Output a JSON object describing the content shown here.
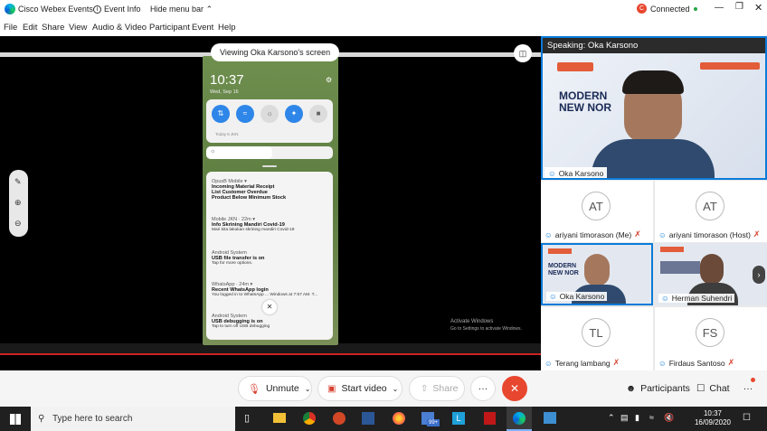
{
  "window": {
    "app_title": "Cisco Webex Events",
    "event_info": "Event Info",
    "hide_menu": "Hide menu bar",
    "status": "Connected"
  },
  "menu": [
    "File",
    "Edit",
    "Share",
    "View",
    "Audio & Video",
    "Participant",
    "Event",
    "Help"
  ],
  "share": {
    "banner": "Viewing Oka Karsono's screen",
    "activate_title": "Activate Windows",
    "activate_sub": "Go to Settings to activate Windows."
  },
  "phone": {
    "time": "10:37",
    "date": "Wed, Sep 16",
    "weather": "Today 5 JKN",
    "notifications": [
      {
        "app": "OpusB Mobile ▾",
        "lines": [
          {
            "title": "Incoming Material Receipt",
            "text": "Incoming Material Rec..."
          },
          {
            "title": "List Customer Overdue",
            "text": "List Customer Overdue • 9..."
          },
          {
            "title": "Product Below Minimum Stock",
            "text": "There are product..."
          }
        ]
      },
      {
        "app": "Mobile JKN · 22m ▾",
        "lines": [
          {
            "title": "Info Skrining Mandiri Covid-19",
            "text": "Mari kita lakukan skrining mandiri Covid-19"
          }
        ]
      },
      {
        "app": "Android System",
        "lines": [
          {
            "title": "USB file transfer is on",
            "text": "Tap for more options."
          }
        ]
      },
      {
        "app": "WhatsApp · 24m ▾",
        "lines": [
          {
            "title": "Recent WhatsApp login",
            "text": "You logged in to WhatsApp ... Windows at 7:57 AM. T..."
          }
        ]
      },
      {
        "app": "Android System",
        "lines": [
          {
            "title": "USB debugging is on",
            "text": "Tap to turn off USB debugging"
          }
        ]
      }
    ]
  },
  "panel": {
    "speaking_label": "Speaking: Oka Karsono",
    "slide_title": "MODERN NEW NOR",
    "speaker_name": "Oka Karsono",
    "participants": [
      {
        "initials": "AT",
        "name": "ariyani timorason (Me)"
      },
      {
        "initials": "AT",
        "name": "ariyani timorason (Host)"
      },
      {
        "initials": "",
        "name": "Oka Karsono"
      },
      {
        "initials": "",
        "name": "Herman Suhendri"
      },
      {
        "initials": "TL",
        "name": "Terang lambang"
      },
      {
        "initials": "FS",
        "name": "Firdaus Santoso"
      }
    ]
  },
  "controls": {
    "unmute": "Unmute",
    "start_video": "Start video",
    "share": "Share",
    "more": "···",
    "participants": "Participants",
    "chat": "Chat"
  },
  "taskbar": {
    "search_placeholder": "Type here to search",
    "badge": "99+",
    "time": "10:37",
    "date": "16/09/2020"
  },
  "colors": {
    "accent": "#0b7bd8",
    "leave": "#e8472f",
    "phone_bg": "#6f8f4f"
  }
}
